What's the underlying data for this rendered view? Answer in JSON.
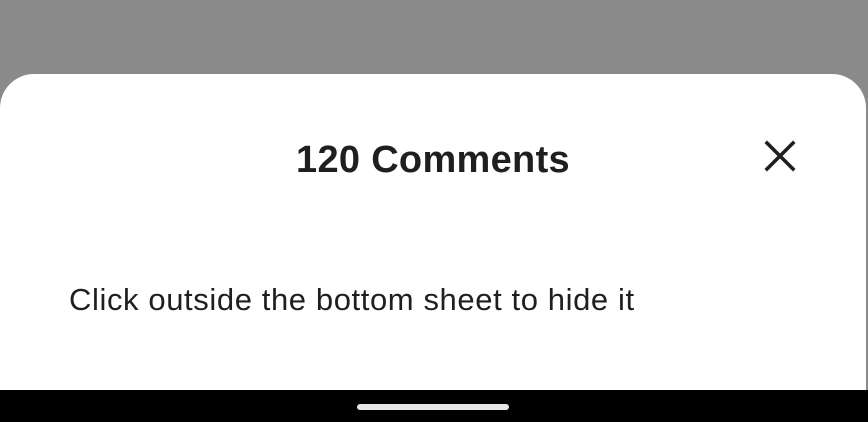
{
  "sheet": {
    "title": "120 Comments",
    "body_text": "Click outside the bottom sheet to hide it",
    "close_icon": "close-icon"
  },
  "colors": {
    "scrim": "#8a8a8a",
    "sheet_background": "#ffffff",
    "text": "#1f1f1f",
    "nav_bar": "#000000",
    "home_indicator": "#e6e6e6"
  }
}
